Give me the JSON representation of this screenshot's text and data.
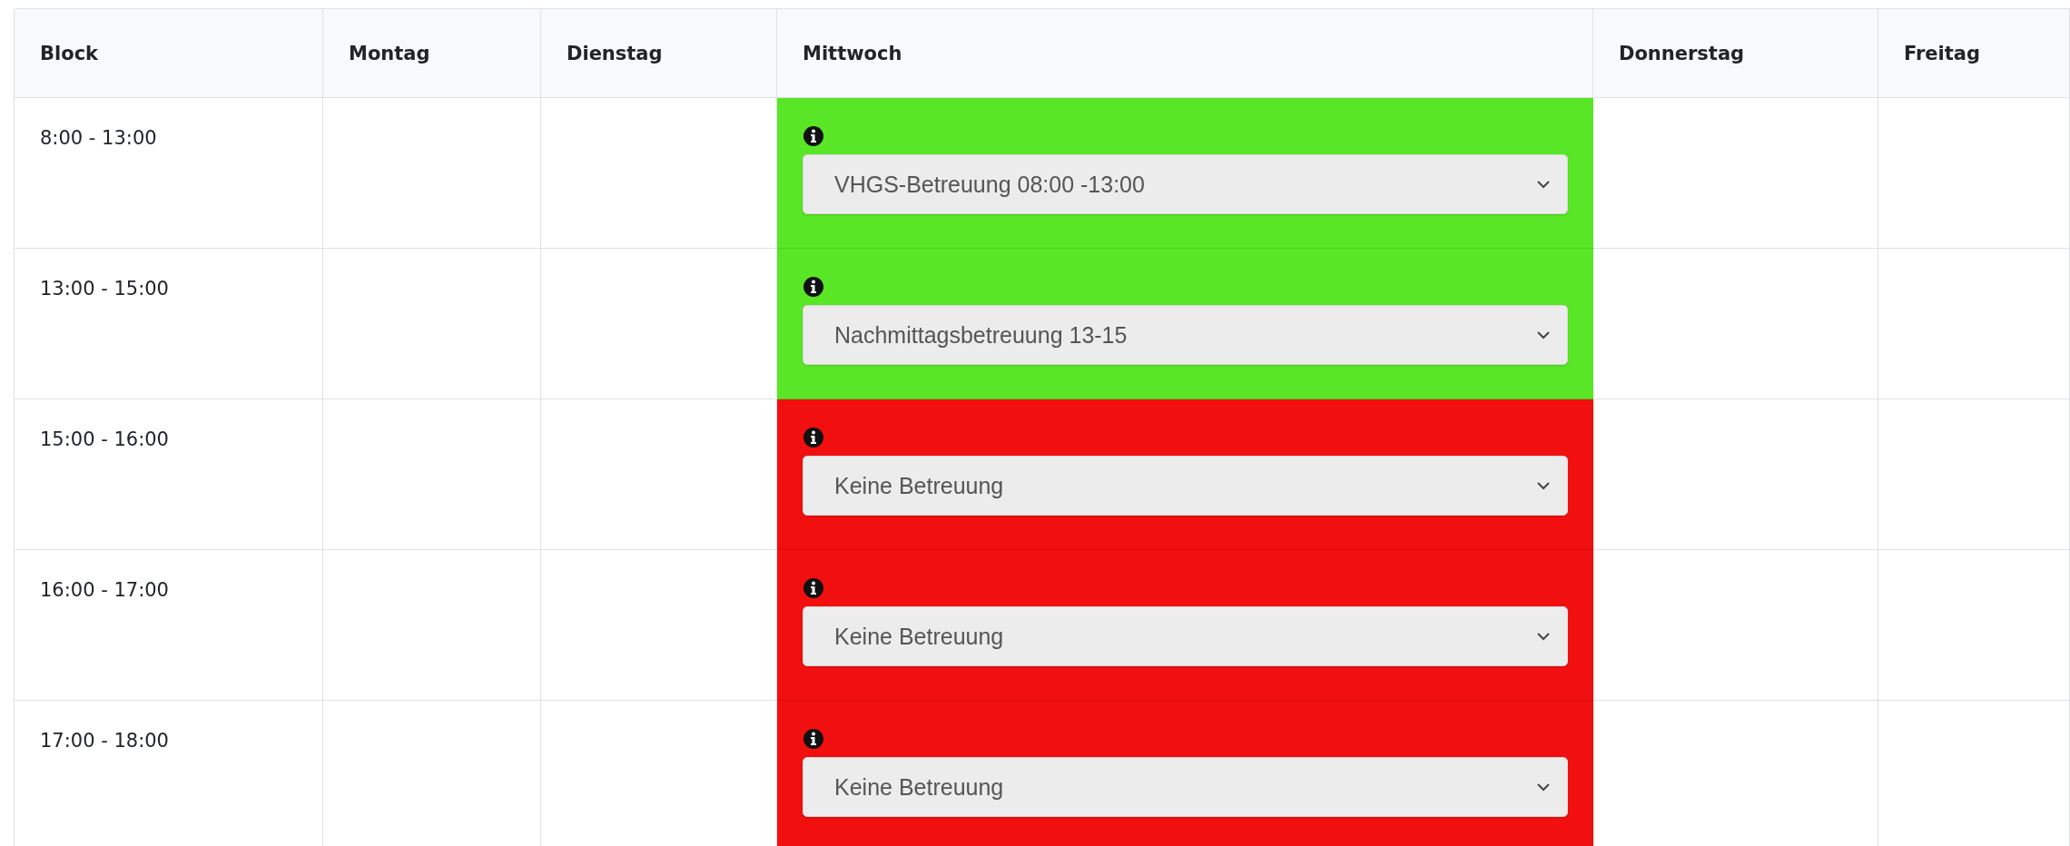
{
  "table": {
    "columns": [
      "Block",
      "Montag",
      "Dienstag",
      "Mittwoch",
      "Donnerstag",
      "Freitag"
    ],
    "rows": [
      {
        "block": "8:00 - 13:00",
        "mittwoch": {
          "color": "#58e626",
          "value": "VHGS-Betreuung 08:00 -13:00"
        }
      },
      {
        "block": "13:00 - 15:00",
        "mittwoch": {
          "color": "#58e626",
          "value": "Nachmittagsbetreuung 13-15"
        }
      },
      {
        "block": "15:00 - 16:00",
        "mittwoch": {
          "color": "#f20f0f",
          "value": "Keine Betreuung"
        }
      },
      {
        "block": "16:00 - 17:00",
        "mittwoch": {
          "color": "#f20f0f",
          "value": "Keine Betreuung"
        }
      },
      {
        "block": "17:00 - 18:00",
        "mittwoch": {
          "color": "#f20f0f",
          "value": "Keine Betreuung"
        }
      }
    ]
  }
}
